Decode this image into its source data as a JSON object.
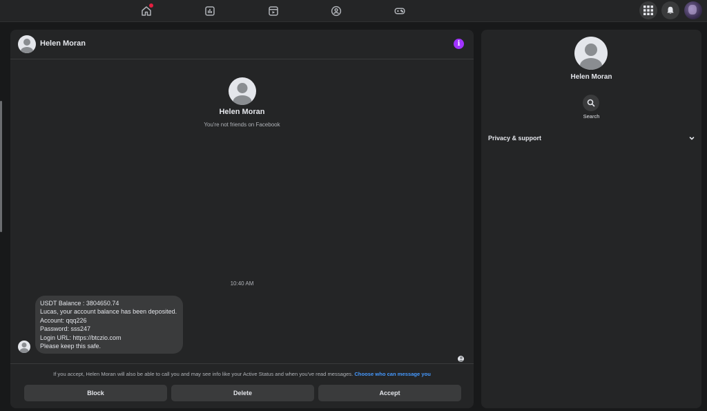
{
  "nav": {
    "icons": [
      "home-icon",
      "feeds-icon",
      "video-icon",
      "groups-icon",
      "gaming-icon"
    ],
    "right_icons": [
      "menu-grid-icon",
      "notifications-icon",
      "profile-avatar"
    ]
  },
  "chat": {
    "contact_name": "Helen Moran",
    "intro_name": "Helen Moran",
    "intro_subtitle": "You're not friends on Facebook",
    "timestamp": "10:40 AM",
    "message_lines": [
      "USDT Balance : 3804650.74",
      "Lucas, your account balance has been deposited.",
      "Account: qqq226",
      "Password: sss247",
      "Login URL: https://btczio.com",
      "Please keep this safe."
    ],
    "consent_text": "If you accept, Helen Moran will also be able to call you and may see info like your Active Status and when you've read messages.",
    "consent_link": "Choose who can message you",
    "buttons": {
      "block": "Block",
      "delete": "Delete",
      "accept": "Accept"
    }
  },
  "info_panel": {
    "name": "Helen Moran",
    "search_label": "Search",
    "privacy_label": "Privacy & support"
  },
  "colors": {
    "background": "#18191a",
    "panel": "#242526",
    "bubble": "#3a3b3c",
    "accent_link": "#4599ff",
    "info_button": "#a033ff",
    "notification_dot": "#e41e3f"
  }
}
